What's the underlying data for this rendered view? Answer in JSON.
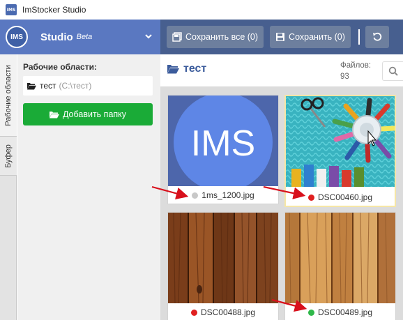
{
  "window": {
    "title": "ImStocker Studio",
    "icon_text": "IMS"
  },
  "header": {
    "logo_text": "IMS",
    "studio_label": "Studio",
    "beta_label": "Beta",
    "save_all_label": "Сохранить все (0)",
    "save_label": "Сохранить (0)"
  },
  "tabs": [
    {
      "label": "Рабочие области"
    },
    {
      "label": "Буфер"
    }
  ],
  "left_panel": {
    "title": "Рабочие области:",
    "folder_name": "тест",
    "folder_path": "(C:\\тест)",
    "add_folder_label": "Добавить папку"
  },
  "main": {
    "folder_title": "тест",
    "files_label": "Файлов:",
    "files_count": "93"
  },
  "files": [
    {
      "name": "1ms_1200.jpg",
      "status": "gray",
      "status_color": "#c8c8c8",
      "thumbnail": "ims-logo",
      "logo_text": "IMS"
    },
    {
      "name": "DSC00460.jpg",
      "status": "red",
      "status_color": "#e02020",
      "thumbnail": "sewing-threads",
      "selected": true
    },
    {
      "name": "DSC00488.jpg",
      "status": "red",
      "status_color": "#e02020",
      "thumbnail": "dark-wood"
    },
    {
      "name": "DSC00489.jpg",
      "status": "green",
      "status_color": "#2fb84a",
      "thumbnail": "light-wood"
    }
  ],
  "colors": {
    "header_blue": "#5a78c1",
    "header_dark": "#475f8f",
    "button_gray": "#6d7f9e",
    "add_green": "#1aab37",
    "arrow_red": "#d8101c"
  }
}
